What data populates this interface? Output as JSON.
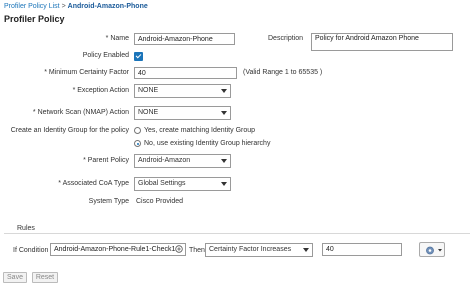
{
  "breadcrumb": {
    "parent": "Profiler Policy List",
    "separator": ">",
    "current": "Android-Amazon-Phone"
  },
  "page_title": "Profiler Policy",
  "form": {
    "name": {
      "label": "* Name",
      "value": "Android-Amazon-Phone"
    },
    "description": {
      "label": "Description",
      "value": "Policy for Android Amazon Phone"
    },
    "policy_enabled": {
      "label": "Policy Enabled",
      "checked": true
    },
    "min_certainty": {
      "label": "* Minimum Certainty Factor",
      "value": "40",
      "hint": "(Valid Range 1 to 65535 )"
    },
    "exception_action": {
      "label": "* Exception Action",
      "value": "NONE"
    },
    "network_scan": {
      "label": "* Network Scan (NMAP) Action",
      "value": "NONE"
    },
    "identity_group": {
      "label": "Create an Identity Group for the policy",
      "option_yes": "Yes, create matching Identity Group",
      "option_no": "No, use existing Identity Group hierarchy",
      "selected": "no"
    },
    "parent_policy": {
      "label": "* Parent Policy",
      "value": "Android-Amazon"
    },
    "coa_type": {
      "label": "* Associated CoA Type",
      "value": "Global Settings"
    },
    "system_type": {
      "label": "System Type",
      "value": "Cisco Provided"
    }
  },
  "rules": {
    "title": "Rules",
    "if_label": "If Condition",
    "condition": "Android-Amazon-Phone-Rule1-Check1",
    "then_label": "Then",
    "action": "Certainty Factor Increases",
    "value": "40"
  },
  "buttons": {
    "save": "Save",
    "reset": "Reset"
  },
  "colors": {
    "accent": "#1a74b9"
  }
}
